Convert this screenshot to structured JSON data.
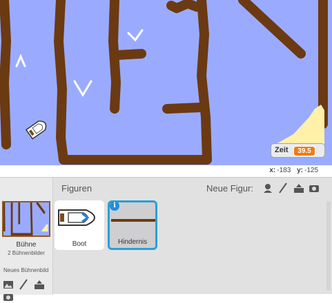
{
  "monitor": {
    "label": "Zeit",
    "value": "39.5"
  },
  "coords": {
    "x_label": "x:",
    "x_value": "-183",
    "y_label": "y:",
    "y_value": "-125"
  },
  "stage_panel": {
    "name": "Bühne",
    "count": "2 Bühnenbilder",
    "new_backdrop": "Neues Bühnenbild"
  },
  "sprites_header": {
    "title": "Figuren",
    "new_sprite": "Neue Figur:"
  },
  "sprites": [
    {
      "name": "Boot"
    },
    {
      "name": "Hindernis",
      "info": "i"
    }
  ],
  "icons": [
    "sprite-library-icon",
    "paint-icon",
    "upload-icon",
    "camera-icon"
  ],
  "colors": {
    "water": "#9aabff",
    "wall": "#6b3a12",
    "sand": "#fff1a8",
    "selection": "#2a9fd6",
    "monitor_value": "#ee7d16"
  }
}
